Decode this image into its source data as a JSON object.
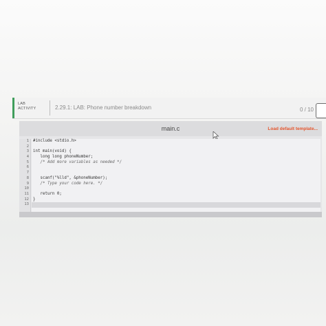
{
  "lab": {
    "tag_line1": "LAB",
    "tag_line2": "ACTIVITY",
    "title": "2.29.1: LAB: Phone number breakdown",
    "score": "0 / 10"
  },
  "editor": {
    "filename": "main.c",
    "load_default_label": "Load default template...",
    "line_numbers": [
      "1",
      "2",
      "3",
      "4",
      "5",
      "6",
      "7",
      "8",
      "9",
      "10",
      "11",
      "12",
      "13"
    ],
    "lines": [
      "#include <stdio.h>",
      "",
      "int main(void) {",
      "   long long phoneNumber;",
      "   /* Add more variables as needed */",
      "",
      "",
      "   scanf(\"%lld\", &phoneNumber);",
      "   /* Type your code here. */",
      "",
      "   return 0;",
      "}",
      ""
    ]
  },
  "colors": {
    "accent": "#3f9d5b",
    "link": "#e4552d"
  }
}
